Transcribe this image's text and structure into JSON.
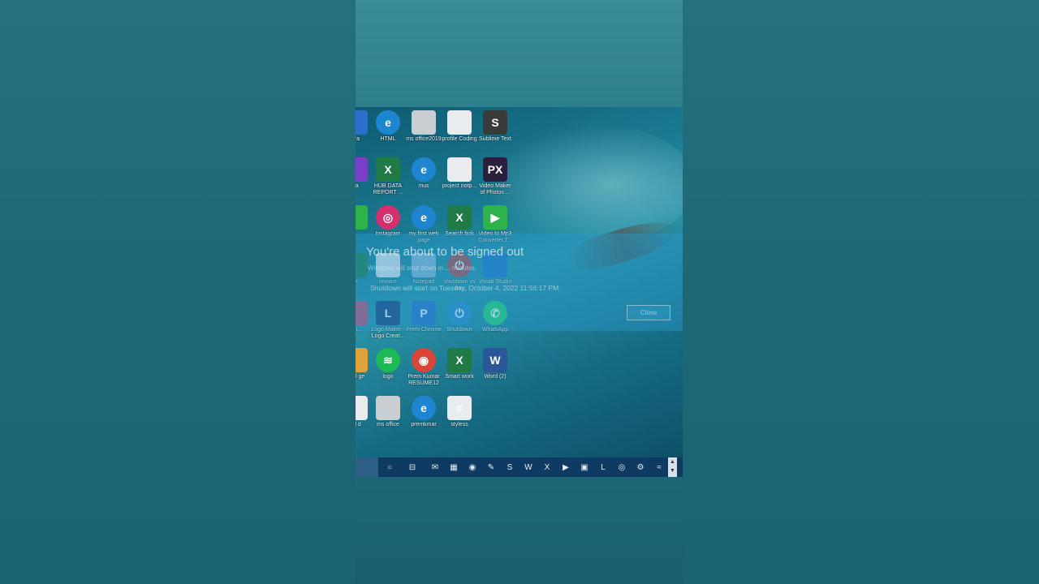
{
  "desktop": {
    "icons": [
      {
        "label": "era",
        "col": 0,
        "row": 0,
        "color": "#2a6fc9",
        "glyph": ""
      },
      {
        "label": "HTML",
        "col": 1,
        "row": 0,
        "color": "#1e86d0",
        "glyph": "e"
      },
      {
        "label": "ms office2019",
        "col": 2,
        "row": 0,
        "color": "#c9ced3",
        "glyph": ""
      },
      {
        "label": "profile Coding",
        "col": 3,
        "row": 0,
        "color": "#e9ecef",
        "glyph": ""
      },
      {
        "label": "Sublime Text",
        "col": 4,
        "row": 0,
        "color": "#3a3a3a",
        "glyph": "S"
      },
      {
        "label": "va",
        "col": 0,
        "row": 1,
        "color": "#7b3fc7",
        "glyph": ""
      },
      {
        "label": "HUB DATA REPORT ...",
        "col": 1,
        "row": 1,
        "color": "#1f7a45",
        "glyph": "X"
      },
      {
        "label": "mus",
        "col": 2,
        "row": 1,
        "color": "#1e86d0",
        "glyph": "e"
      },
      {
        "label": "project notp...",
        "col": 3,
        "row": 1,
        "color": "#e9ecef",
        "glyph": ""
      },
      {
        "label": "Video Maker of Photos ...",
        "col": 4,
        "row": 1,
        "color": "#2a1f3d",
        "glyph": "PX"
      },
      {
        "label": "",
        "col": 0,
        "row": 2,
        "color": "#2eb24a",
        "glyph": ""
      },
      {
        "label": "Instagram",
        "col": 1,
        "row": 2,
        "color": "#d4306e",
        "glyph": "◎"
      },
      {
        "label": "my first web page",
        "col": 2,
        "row": 2,
        "color": "#1e86d0",
        "glyph": "e"
      },
      {
        "label": "Search bok",
        "col": 3,
        "row": 2,
        "color": "#1f7a45",
        "glyph": "X"
      },
      {
        "label": "Video to Mp3 Converter,T...",
        "col": 4,
        "row": 2,
        "color": "#2eb24a",
        "glyph": "▶"
      },
      {
        "label": "el",
        "col": 0,
        "row": 3,
        "color": "#1f7a45",
        "glyph": ""
      },
      {
        "label": "invoice",
        "col": 1,
        "row": 3,
        "color": "#e9ecef",
        "glyph": ""
      },
      {
        "label": "Notepad",
        "col": 2,
        "row": 3,
        "color": "#8fb7d8",
        "glyph": ""
      },
      {
        "label": "shutdown vs bay",
        "col": 3,
        "row": 3,
        "color": "#b74a4a",
        "glyph": "⏻"
      },
      {
        "label": "Visual Studio ...",
        "col": 4,
        "row": 3,
        "color": "#2473c9",
        "glyph": ""
      },
      {
        "label": "Edi...",
        "col": 0,
        "row": 4,
        "color": "#c94a6a",
        "glyph": ""
      },
      {
        "label": "Logo Maker - Logo Creat...",
        "col": 1,
        "row": 4,
        "color": "#1d3f7a",
        "glyph": "L"
      },
      {
        "label": "Prem Chrome",
        "col": 2,
        "row": 4,
        "color": "#2a6fc9",
        "glyph": "P"
      },
      {
        "label": "Shutdown",
        "col": 3,
        "row": 4,
        "color": "#2a8ad0",
        "glyph": "⏻"
      },
      {
        "label": "WhatsApp",
        "col": 4,
        "row": 4,
        "color": "#25d366",
        "glyph": "✆"
      },
      {
        "label": "finel ge",
        "col": 0,
        "row": 5,
        "color": "#e0a13a",
        "glyph": ""
      },
      {
        "label": "logo",
        "col": 1,
        "row": 5,
        "color": "#1db954",
        "glyph": "≋"
      },
      {
        "label": "Prem Kumar RESUME12",
        "col": 2,
        "row": 5,
        "color": "#db4437",
        "glyph": "◉"
      },
      {
        "label": "Smart work",
        "col": 3,
        "row": 5,
        "color": "#1f7a45",
        "glyph": "X"
      },
      {
        "label": "Word (2)",
        "col": 4,
        "row": 5,
        "color": "#2b579a",
        "glyph": "W"
      },
      {
        "label": "nd d",
        "col": 0,
        "row": 6,
        "color": "#e9ecef",
        "glyph": ""
      },
      {
        "label": "ms office",
        "col": 1,
        "row": 6,
        "color": "#c9ced3",
        "glyph": ""
      },
      {
        "label": "premkmar",
        "col": 2,
        "row": 6,
        "color": "#1e86d0",
        "glyph": "e"
      },
      {
        "label": "styless",
        "col": 3,
        "row": 6,
        "color": "#e9ecef",
        "glyph": "#"
      }
    ]
  },
  "dialog": {
    "title": "You're about to be signed out",
    "subtitle": "Windows will shut down in ... minutes.",
    "info": "Shutdown will start on Tuesday, October 4, 2022 11:56:17 PM.",
    "close_label": "Close"
  },
  "taskbar": {
    "items": [
      {
        "name": "cortana-icon",
        "glyph": "○"
      },
      {
        "name": "task-view-icon",
        "glyph": "⊟"
      },
      {
        "name": "mail-icon",
        "glyph": "✉"
      },
      {
        "name": "store-icon",
        "glyph": "▦"
      },
      {
        "name": "media-icon",
        "glyph": "◉"
      },
      {
        "name": "notepad-icon",
        "glyph": "✎"
      },
      {
        "name": "sublime-icon",
        "glyph": "S"
      },
      {
        "name": "word-icon",
        "glyph": "W"
      },
      {
        "name": "excel-icon",
        "glyph": "X"
      },
      {
        "name": "video-converter-icon",
        "glyph": "▶"
      },
      {
        "name": "video-maker-icon",
        "glyph": "▣"
      },
      {
        "name": "logo-maker-icon",
        "glyph": "L"
      },
      {
        "name": "chrome-icon",
        "glyph": "◎"
      },
      {
        "name": "settings-icon",
        "glyph": "⚙"
      },
      {
        "name": "tray-app-icon",
        "glyph": "≈"
      }
    ],
    "scroll_up": "▲",
    "scroll_down": "▼"
  }
}
